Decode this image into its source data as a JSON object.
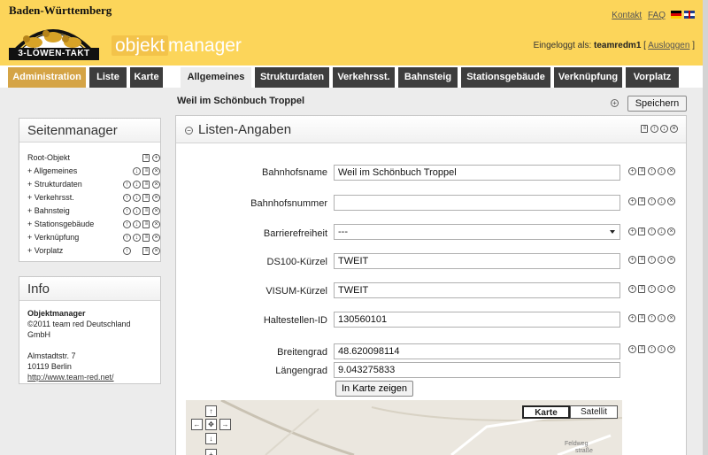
{
  "header": {
    "state": "Baden-Württemberg",
    "logo_text": "3-LÖWEN-TAKT",
    "app_title_box": "objekt",
    "app_title_rest": "manager",
    "links": {
      "kontakt": "Kontakt",
      "faq": "FAQ"
    },
    "login_prefix": "Eingeloggt als:",
    "login_user": "teamredm1",
    "logout_label": "Ausloggen"
  },
  "tabs": [
    {
      "label": "Administration"
    },
    {
      "label": "Liste"
    },
    {
      "label": "Karte"
    },
    {
      "label": "Allgemeines"
    },
    {
      "label": "Strukturdaten"
    },
    {
      "label": "Verkehrsst."
    },
    {
      "label": "Bahnsteig"
    },
    {
      "label": "Stationsgebäude"
    },
    {
      "label": "Verknüpfung"
    },
    {
      "label": "Vorplatz"
    }
  ],
  "page": {
    "heading": "Weil im Schönbuch Troppel",
    "save_label": "Speichern"
  },
  "sidebar": {
    "seitenmanager_title": "Seitenmanager",
    "items": [
      {
        "label": "Root-Objekt"
      },
      {
        "label": "+ Allgemeines"
      },
      {
        "label": "+ Strukturdaten"
      },
      {
        "label": "+ Verkehrsst."
      },
      {
        "label": "+ Bahnsteig"
      },
      {
        "label": "+ Stationsgebäude"
      },
      {
        "label": "+ Verknüpfung"
      },
      {
        "label": "+ Vorplatz"
      }
    ],
    "info_title": "Info",
    "info": {
      "name": "Objektmanager",
      "copyright": "©2011 team red Deutschland GmbH",
      "street": "Almstadtstr. 7",
      "city": "10119 Berlin",
      "url": "http://www.team-red.net/"
    }
  },
  "panel": {
    "title": "Listen-Angaben",
    "fields": [
      {
        "label": "Bahnhofsname",
        "value": "Weil im Schönbuch Troppel"
      },
      {
        "label": "Bahnhofsnummer",
        "value": ""
      },
      {
        "label": "Barrierefreiheit",
        "value": "---"
      },
      {
        "label": "DS100-Kürzel",
        "value": "TWEIT"
      },
      {
        "label": "VISUM-Kürzel",
        "value": "TWEIT"
      },
      {
        "label": "Haltestellen-ID",
        "value": "130560101"
      },
      {
        "label": "Breitengrad",
        "value": "48.620098114"
      },
      {
        "label": "Längengrad",
        "value": "9.043275833"
      }
    ],
    "map_button": "In Karte zeigen"
  },
  "map": {
    "type_karte": "Karte",
    "type_satellit": "Satellit",
    "street_label_1": "Feldweg",
    "street_label_2": "straße"
  },
  "colors": {
    "header_bg": "#fcd55a",
    "tab_dark": "#3d3d3d",
    "tab_admin": "#d5a446"
  }
}
